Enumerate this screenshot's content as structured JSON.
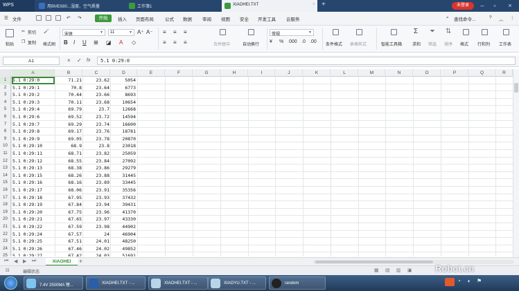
{
  "titlebar": {
    "brand": "WPS",
    "tabs": [
      {
        "label": "用BME680...湿度、空气质量"
      },
      {
        "label": "工作簿1"
      },
      {
        "label": "XIAOHEI.TXT"
      }
    ],
    "login": "未登录"
  },
  "menu": {
    "file": "文件",
    "start": "开始",
    "items": [
      "插入",
      "页面布局",
      "公式",
      "数据",
      "审阅",
      "视图",
      "安全",
      "开发工具",
      "云服务"
    ],
    "search": "查找命令..."
  },
  "ribbon": {
    "paste": "粘贴",
    "cut": "剪切",
    "copy": "复制",
    "format_painter": "格式刷",
    "font_name": "宋体",
    "font_size": "11",
    "merge_center": "合并居中",
    "wrap": "自动换行",
    "number_format": "常规",
    "conditional": "条件格式",
    "table_style": "表格样式",
    "smart_toolbox": "智能工具箱",
    "sum": "求和",
    "filter": "筛选",
    "sort": "排序",
    "format": "格式",
    "rowcol": "行和列",
    "worksheet": "工作表"
  },
  "formula_bar": {
    "cell_ref": "A1",
    "fx": "fx",
    "content": "5.1 0:29:0"
  },
  "columns": [
    "A",
    "B",
    "C",
    "D",
    "E",
    "F",
    "G",
    "H",
    "I",
    "J",
    "K",
    "L",
    "M",
    "N",
    "O",
    "P",
    "Q",
    "R"
  ],
  "rows": [
    {
      "n": "1",
      "a": "5.1 0:29:0",
      "b": "71.21",
      "c": "23.62",
      "d": "5054"
    },
    {
      "n": "2",
      "a": "5.1 0:29:1",
      "b": "70.8",
      "c": "23.64",
      "d": "6773"
    },
    {
      "n": "3",
      "a": "5.1 0:29:2",
      "b": "70.44",
      "c": "23.66",
      "d": "8693"
    },
    {
      "n": "4",
      "a": "5.1 0:29:3",
      "b": "70.11",
      "c": "23.68",
      "d": "10654"
    },
    {
      "n": "5",
      "a": "5.1 0:29:4",
      "b": "69.79",
      "c": "23.7",
      "d": "12668"
    },
    {
      "n": "6",
      "a": "5.1 0:29:6",
      "b": "69.52",
      "c": "23.72",
      "d": "14594"
    },
    {
      "n": "7",
      "a": "5.1 0:29:7",
      "b": "69.29",
      "c": "23.74",
      "d": "16600"
    },
    {
      "n": "8",
      "a": "5.1 0:29:8",
      "b": "69.17",
      "c": "23.76",
      "d": "18781"
    },
    {
      "n": "9",
      "a": "5.1 0:29:9",
      "b": "69.05",
      "c": "23.78",
      "d": "20870"
    },
    {
      "n": "10",
      "a": "5.1 0:29:10",
      "b": "68.9",
      "c": "23.8",
      "d": "23018"
    },
    {
      "n": "11",
      "a": "5.1 0:29:11",
      "b": "68.71",
      "c": "23.82",
      "d": "25059"
    },
    {
      "n": "12",
      "a": "5.1 0:29:12",
      "b": "68.55",
      "c": "23.84",
      "d": "27092"
    },
    {
      "n": "13",
      "a": "5.1 0:29:13",
      "b": "68.38",
      "c": "23.86",
      "d": "29279"
    },
    {
      "n": "14",
      "a": "5.1 0:29:15",
      "b": "68.26",
      "c": "23.88",
      "d": "31445"
    },
    {
      "n": "15",
      "a": "5.1 0:29:16",
      "b": "68.16",
      "c": "23.89",
      "d": "33445"
    },
    {
      "n": "16",
      "a": "5.1 0:29:17",
      "b": "68.06",
      "c": "23.91",
      "d": "35356"
    },
    {
      "n": "17",
      "a": "5.1 0:29:18",
      "b": "67.95",
      "c": "23.93",
      "d": "37432"
    },
    {
      "n": "18",
      "a": "5.1 0:29:19",
      "b": "67.84",
      "c": "23.94",
      "d": "39431"
    },
    {
      "n": "19",
      "a": "5.1 0:29:20",
      "b": "67.75",
      "c": "23.96",
      "d": "41370"
    },
    {
      "n": "20",
      "a": "5.1 0:29:21",
      "b": "67.65",
      "c": "23.97",
      "d": "43330"
    },
    {
      "n": "21",
      "a": "5.1 0:29:22",
      "b": "67.59",
      "c": "23.98",
      "d": "44902"
    },
    {
      "n": "22",
      "a": "5.1 0:29:24",
      "b": "67.57",
      "c": "24",
      "d": "46904"
    },
    {
      "n": "23",
      "a": "5.1 0:29:25",
      "b": "67.51",
      "c": "24.01",
      "d": "48250"
    },
    {
      "n": "24",
      "a": "5.1 0:29:26",
      "b": "67.46",
      "c": "24.02",
      "d": "49852"
    },
    {
      "n": "25",
      "a": "5.1 0:29:27",
      "b": "67.42",
      "c": "24.03",
      "d": "51691"
    },
    {
      "n": "26",
      "a": "5.1 0:29:28",
      "b": "67.36",
      "c": "24.04",
      "d": "53230"
    }
  ],
  "sheet_tab": "XIAOHEI",
  "add_sheet": "+",
  "status": "编辑状态",
  "taskbar": {
    "tasks": [
      {
        "label": "7.4V 2500MA 锂..."
      },
      {
        "label": "XIAOHEI.TXT - ..."
      },
      {
        "label": "XIAOHEI.TXT - ..."
      },
      {
        "label": "XIAOYU.TXT - ..."
      },
      {
        "label": "random"
      }
    ]
  },
  "colors": {
    "accent": "#3c9a3e",
    "titlebar": "#27466e",
    "login": "#d9352c"
  }
}
